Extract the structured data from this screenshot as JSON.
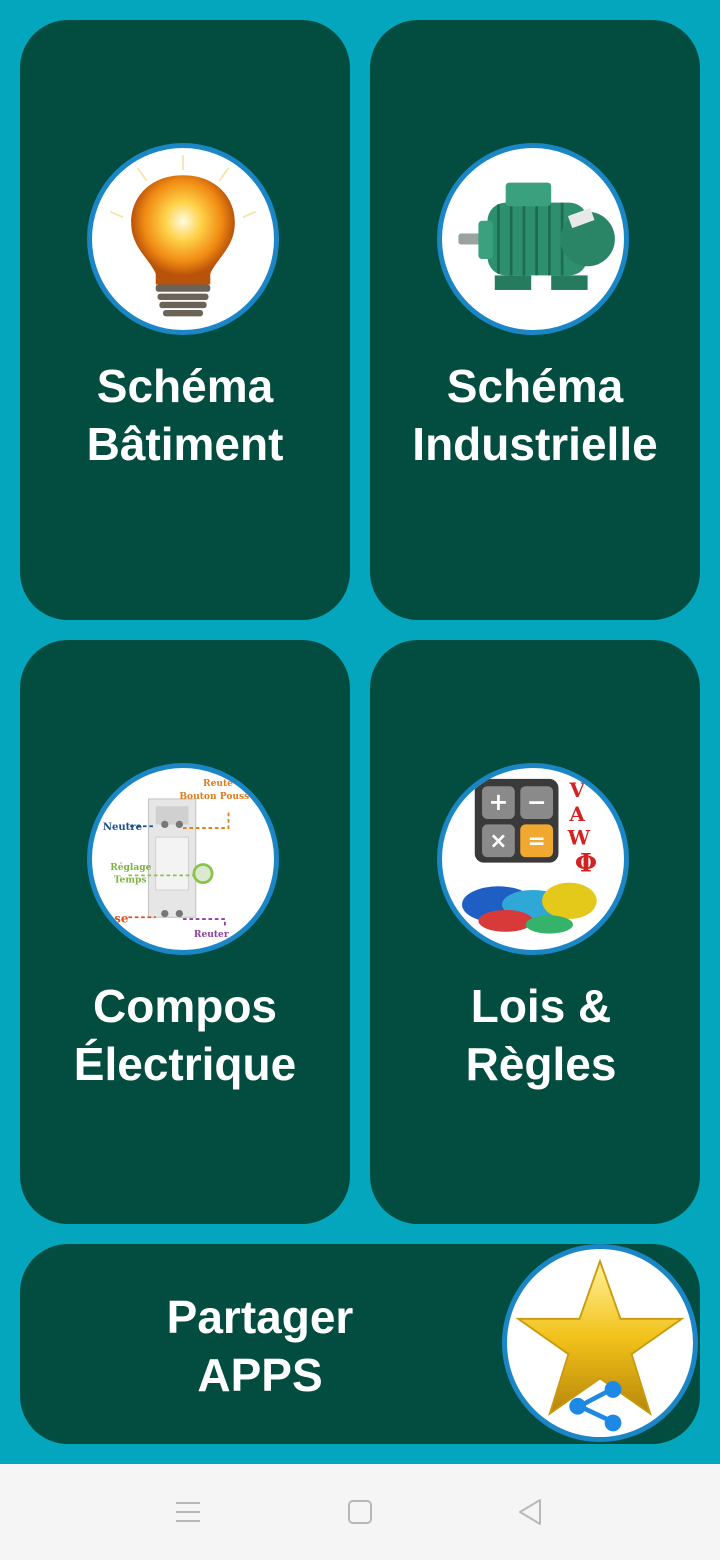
{
  "cards": {
    "batiment": {
      "line1": "Schéma",
      "line2": "Bâtiment",
      "icon": "light-bulb-icon"
    },
    "industrielle": {
      "line1": "Schéma",
      "line2": "Industrielle",
      "icon": "electric-motor-icon"
    },
    "compos": {
      "line1": "Compos",
      "line2": "Électrique",
      "icon": "relay-component-icon",
      "image_labels": {
        "neutre": "Neutre",
        "bouton": "Bouton Pouss",
        "reuter_top": "Reute",
        "reglage": "Réglage",
        "temps": "Temps",
        "phase": "ase",
        "reuter_bottom": "Reuter"
      }
    },
    "lois": {
      "line1": "Lois &",
      "line2": "Règles",
      "icon": "calculator-cables-icon",
      "image_labels": {
        "v": "V",
        "a": "A",
        "w": "W",
        "phi": "Φ",
        "plus": "+",
        "minus": "−",
        "times": "×",
        "equals": "="
      }
    },
    "share": {
      "line1": "Partager",
      "line2": "APPS",
      "icon": "star-share-icon"
    }
  },
  "navbar": {
    "menu": "menu-icon",
    "home": "home-square-icon",
    "back": "back-triangle-icon"
  },
  "colors": {
    "background": "#04a6be",
    "card": "#034d40",
    "circle_border": "#1a86c6",
    "text": "#ffffff"
  }
}
